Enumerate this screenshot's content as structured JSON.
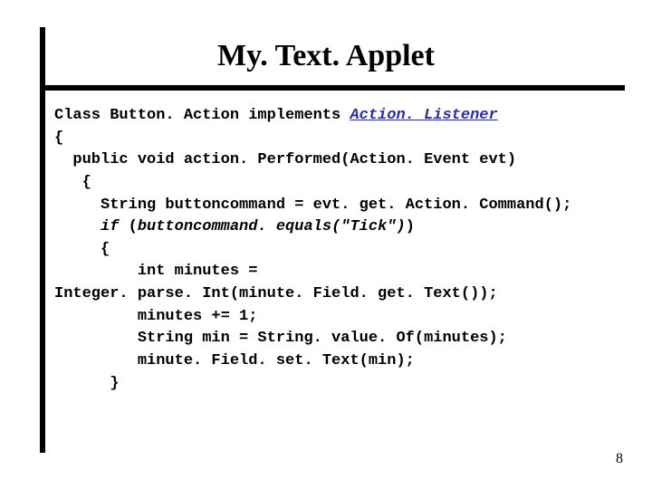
{
  "title": "My. Text. Applet",
  "code": {
    "l1a": "Class Button. Action implements ",
    "l1b": "Action. Listener",
    "l2": "{",
    "l3": "  public void action. Performed(Action. Event evt)",
    "l4": "   {",
    "l5": "     String buttoncommand = evt. get. Action. Command();",
    "l6a": "     ",
    "l6b": "if",
    "l6c": " (",
    "l6d": "buttoncommand. equals(\"Tick\")",
    "l6e": ")",
    "l7": "     {",
    "l8": "         int minutes =",
    "l9": "Integer. parse. Int(minute. Field. get. Text());",
    "l10": "         minutes += 1;",
    "l11": "         String min = String. value. Of(minutes);",
    "l12": "         minute. Field. set. Text(min);",
    "l13": "      }"
  },
  "page_number": "8"
}
